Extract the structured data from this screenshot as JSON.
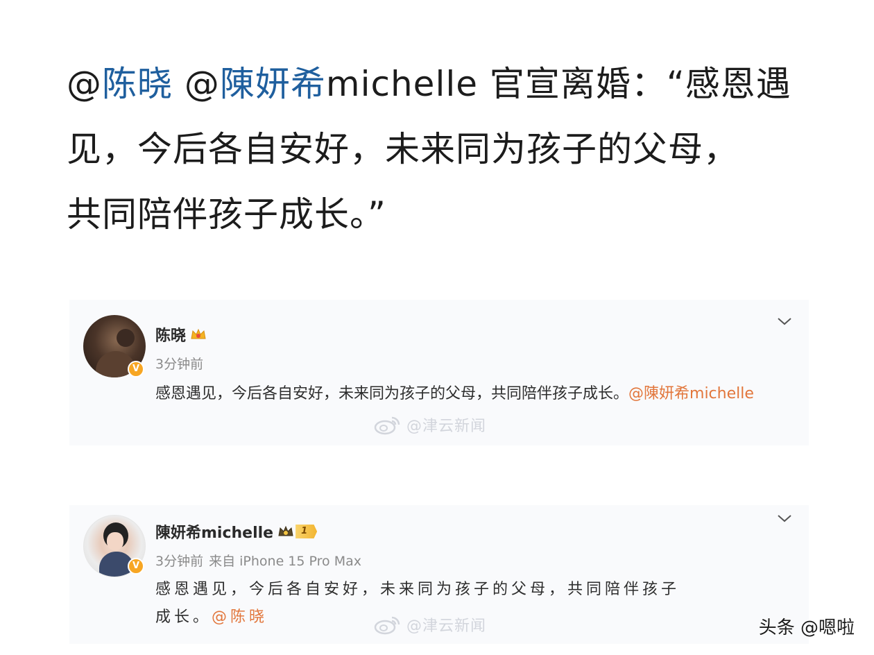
{
  "headline": {
    "at1": "@",
    "mention1": "陈晓",
    "space": " ",
    "at2": "@",
    "mention2": "陳妍希",
    "line1_rest": "michelle 官宣离婚：“感恩遇",
    "line2": "见，今后各自安好，未来同为孩子的父母，",
    "line3": "共同陪伴孩子成长。”"
  },
  "post1": {
    "avatar": "avatar-chenxiao",
    "verified_badge": "V",
    "name": "陈晓",
    "crown_icon": "crown-icon",
    "time": "3分钟前",
    "text": "感恩遇见，今后各自安好，未来同为孩子的父母，共同陪伴孩子成长。",
    "mention": "@陳妍希michelle",
    "watermark": "@津云新闻"
  },
  "post2": {
    "avatar": "avatar-michelle",
    "verified_badge": "V",
    "name": "陳妍希michelle",
    "crown_icon": "crown-icon",
    "level": "1",
    "time": "3分钟前",
    "source": "来自 iPhone 15 Pro Max",
    "text_line1": "感恩遇见，今后各自安好，未来同为孩子的父母，共同陪伴孩子",
    "text_line2": "成长。",
    "mention": "@陈晓",
    "watermark": "@津云新闻"
  },
  "footer": {
    "credit": "头条 @嗯啦"
  },
  "colors": {
    "mention_blue": "#1f5f9e",
    "mention_orange": "#e2763b",
    "verified_orange": "#f7a623",
    "card_bg": "#f9fafc"
  }
}
